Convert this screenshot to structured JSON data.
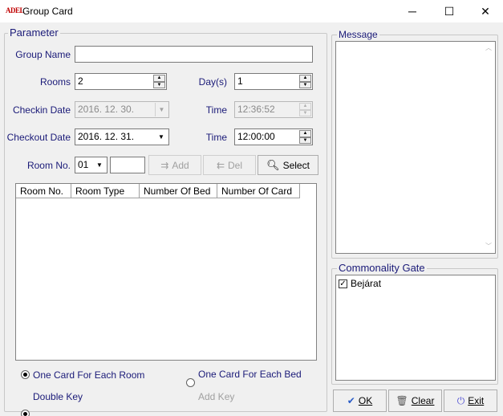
{
  "window": {
    "logo_text": "ADEL",
    "title": "Group Card",
    "minimize": "─",
    "maximize": "☐",
    "close": "✕"
  },
  "parameter": {
    "title": "Parameter",
    "group_name_label": "Group Name",
    "group_name_value": "",
    "rooms_label": "Rooms",
    "rooms_value": "2",
    "days_label": "Day(s)",
    "days_value": "1",
    "checkin_label": "Checkin Date",
    "checkin_value": "2016. 12. 30.",
    "checkin_time_label": "Time",
    "checkin_time_value": "12:36:52",
    "checkout_label": "Checkout Date",
    "checkout_value": "2016. 12. 31.",
    "checkout_time_label": "Time",
    "checkout_time_value": "12:00:00",
    "room_no_label": "Room No.",
    "room_no_value": "01",
    "room_no_extra": "",
    "add_label": "Add",
    "del_label": "Del",
    "select_label": "Select",
    "table": {
      "columns": [
        "Room No.",
        "Room Type",
        "Number Of Bed",
        "Number Of Card"
      ],
      "rows": []
    },
    "options": {
      "card_each_room": "One Card For Each Room",
      "card_each_bed": "One Card For Each Bed",
      "double_key": "Double Key",
      "add_key": "Add Key"
    }
  },
  "message": {
    "title": "Message",
    "content": ""
  },
  "commonality_gate": {
    "title": "Commonality Gate",
    "items": [
      {
        "label": "Bejárat",
        "checked": true
      }
    ]
  },
  "buttons": {
    "ok": "OK",
    "clear": "Clear",
    "exit": "Exit"
  }
}
